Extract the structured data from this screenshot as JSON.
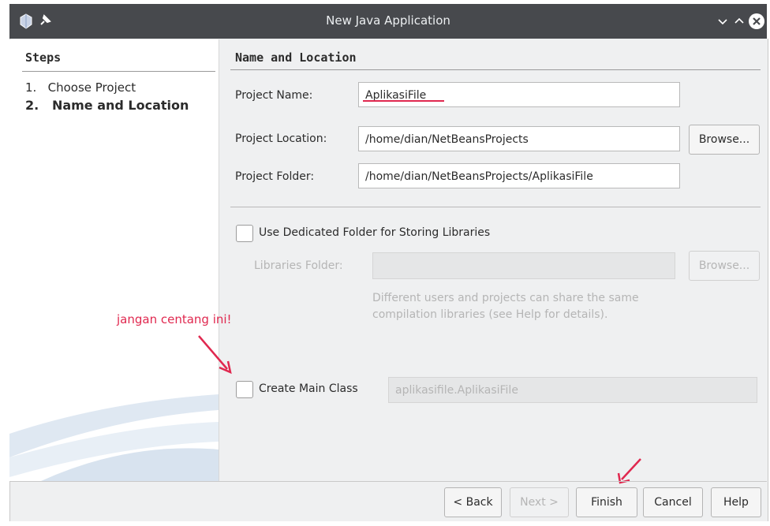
{
  "window": {
    "title": "New Java Application"
  },
  "steps": {
    "header": "Steps",
    "items": [
      {
        "num": "1.",
        "label": "Choose Project"
      },
      {
        "num": "2.",
        "label": "Name and Location"
      }
    ]
  },
  "main": {
    "title": "Name and Location",
    "project_name_label": "Project Name:",
    "project_name_value": "AplikasiFile",
    "project_location_label": "Project Location:",
    "project_location_value": "/home/dian/NetBeansProjects",
    "browse_label": "Browse...",
    "project_folder_label": "Project Folder:",
    "project_folder_value": "/home/dian/NetBeansProjects/AplikasiFile",
    "dedicated_folder_label": "Use Dedicated Folder for Storing Libraries",
    "libraries_folder_label": "Libraries Folder:",
    "libraries_folder_value": "",
    "libraries_browse_label": "Browse...",
    "libraries_description": "Different users and projects can share the same compilation libraries (see Help for details).",
    "create_main_class_label": "Create Main Class",
    "main_class_value": "aplikasifile.AplikasiFile",
    "annotation": "jangan centang ini!"
  },
  "footer": {
    "back": "< Back",
    "next": "Next >",
    "finish": "Finish",
    "cancel": "Cancel",
    "help": "Help"
  },
  "colors": {
    "titlebar": "#47494d",
    "dialog_bg": "#eff0f1",
    "annotation": "#e0284f"
  }
}
